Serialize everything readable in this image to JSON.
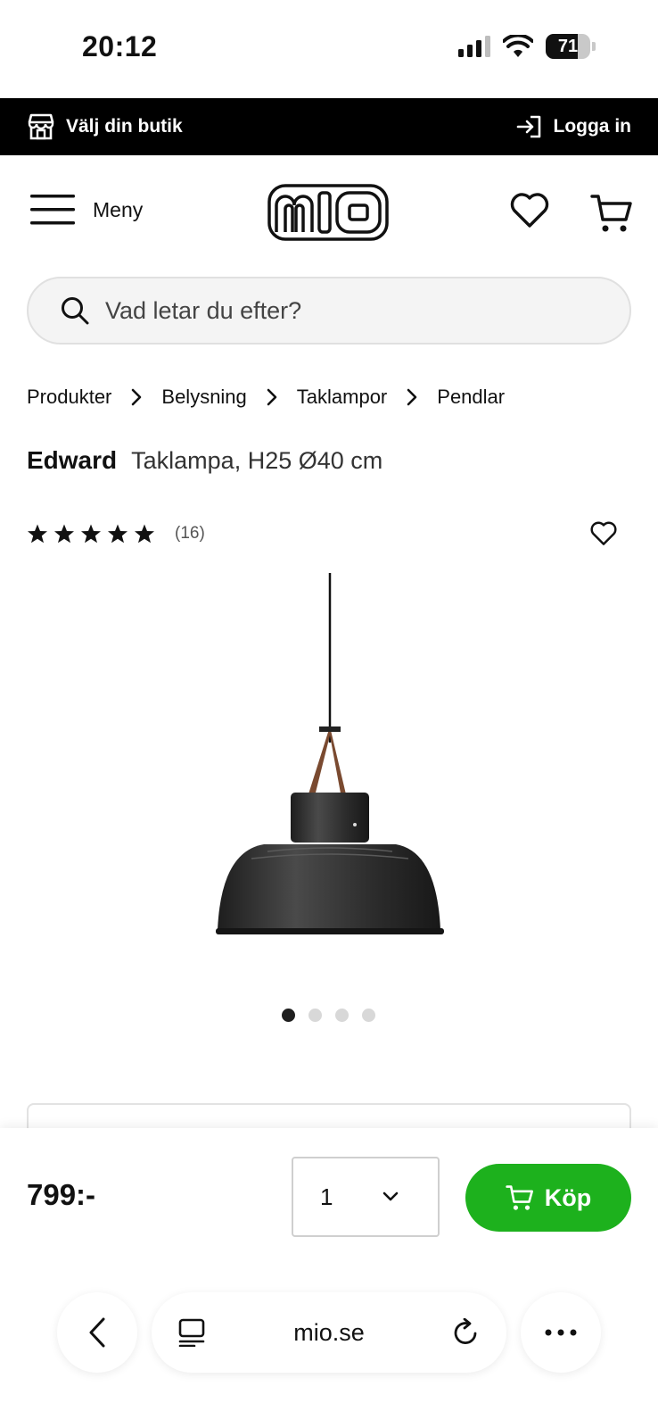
{
  "status_bar": {
    "time": "20:12",
    "battery": "71",
    "battery_level": 0.71,
    "icons": [
      "cellular-signal-icon",
      "wifi-icon",
      "battery-icon"
    ]
  },
  "topbar": {
    "store_label": "Välj din butik",
    "login_label": "Logga in"
  },
  "header": {
    "menu_label": "Meny",
    "logo_text": "mio"
  },
  "search": {
    "placeholder": "Vad letar du efter?"
  },
  "breadcrumb": [
    "Produkter",
    "Belysning",
    "Taklampor",
    "Pendlar"
  ],
  "product": {
    "name": "Edward",
    "description": "Taklampa, H25 Ø40 cm",
    "rating_stars": 5,
    "rating_count": "(16)",
    "image_count": 4,
    "active_image": 1
  },
  "buy_bar": {
    "price": "799:-",
    "quantity": "1",
    "buy_label": "Köp",
    "accent_color": "#1db11d"
  },
  "browser": {
    "url": "mio.se"
  }
}
